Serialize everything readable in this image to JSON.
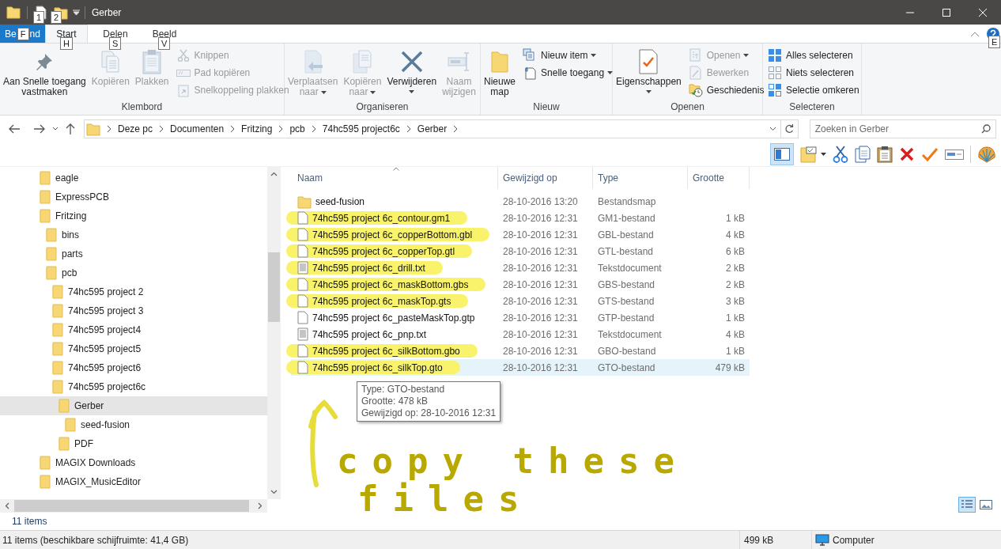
{
  "window": {
    "title": "Gerber",
    "quick_access_key_tips": [
      "1",
      "2"
    ]
  },
  "ribbon_tabs": [
    {
      "kind": "file",
      "label_parts": [
        "Be",
        "nd"
      ],
      "key_tip": "F",
      "selected": false
    },
    {
      "kind": "tab",
      "label": "Start",
      "key_tip": "H",
      "selected": true
    },
    {
      "kind": "tab",
      "label": "Delen",
      "key_tip": "S",
      "selected": false
    },
    {
      "kind": "tab",
      "label": "Beeld",
      "key_tip": "V",
      "selected": false
    }
  ],
  "help_key_tip": "E",
  "ribbon_groups": [
    {
      "label": "Klembord",
      "items": [
        {
          "kind": "large",
          "lines": [
            "Aan Snelle toegang",
            "vastmaken"
          ],
          "disabled": false,
          "dropdown": false
        },
        {
          "kind": "large",
          "lines": [
            "Kopiëren"
          ],
          "disabled": true,
          "dropdown": false
        },
        {
          "kind": "large",
          "lines": [
            "Plakken"
          ],
          "disabled": true,
          "dropdown": false
        },
        {
          "kind": "small",
          "lines": [
            "Knippen"
          ],
          "disabled": true,
          "dropdown": false
        },
        {
          "kind": "small",
          "lines": [
            "Pad kopiëren"
          ],
          "disabled": true,
          "dropdown": false
        },
        {
          "kind": "small",
          "lines": [
            "Snelkoppeling plakken"
          ],
          "disabled": true,
          "dropdown": false
        }
      ]
    },
    {
      "label": "Organiseren",
      "items": [
        {
          "kind": "large",
          "lines": [
            "Verplaatsen",
            "naar"
          ],
          "disabled": true,
          "dropdown": true
        },
        {
          "kind": "large",
          "lines": [
            "Kopiëren",
            "naar"
          ],
          "disabled": true,
          "dropdown": true
        },
        {
          "kind": "large",
          "lines": [
            "Verwijderen"
          ],
          "disabled": false,
          "dropdown": true
        },
        {
          "kind": "large",
          "lines": [
            "Naam",
            "wijzigen"
          ],
          "disabled": true,
          "dropdown": false
        }
      ]
    },
    {
      "label": "Nieuw",
      "items": [
        {
          "kind": "large",
          "lines": [
            "Nieuwe",
            "map"
          ],
          "disabled": false,
          "dropdown": false
        },
        {
          "kind": "small",
          "lines": [
            "Nieuw item"
          ],
          "disabled": false,
          "dropdown": true
        },
        {
          "kind": "small",
          "lines": [
            "Snelle toegang"
          ],
          "disabled": false,
          "dropdown": true
        }
      ]
    },
    {
      "label": "Openen",
      "items": [
        {
          "kind": "large",
          "lines": [
            "Eigenschappen"
          ],
          "disabled": false,
          "dropdown": true
        },
        {
          "kind": "small",
          "lines": [
            "Openen"
          ],
          "disabled": true,
          "dropdown": true
        },
        {
          "kind": "small",
          "lines": [
            "Bewerken"
          ],
          "disabled": true,
          "dropdown": false
        },
        {
          "kind": "small",
          "lines": [
            "Geschiedenis"
          ],
          "disabled": false,
          "dropdown": false
        }
      ]
    },
    {
      "label": "Selecteren",
      "items": [
        {
          "kind": "small",
          "lines": [
            "Alles selecteren"
          ],
          "disabled": false,
          "dropdown": false
        },
        {
          "kind": "small",
          "lines": [
            "Niets selecteren"
          ],
          "disabled": false,
          "dropdown": false
        },
        {
          "kind": "small",
          "lines": [
            "Selectie omkeren"
          ],
          "disabled": false,
          "dropdown": false
        }
      ]
    }
  ],
  "address": {
    "crumbs": [
      "Deze pc",
      "Documenten",
      "Fritzing",
      "pcb",
      "74hc595 project6c",
      "Gerber"
    ]
  },
  "search": {
    "placeholder": "Zoeken in Gerber"
  },
  "preview_pane": {
    "on": true
  },
  "navigation": [
    {
      "label": "eagle",
      "selected": false
    },
    {
      "label": "ExpressPCB",
      "selected": false
    },
    {
      "label": "Fritzing",
      "selected": false,
      "children": [
        {
          "label": "bins",
          "selected": false
        },
        {
          "label": "parts",
          "selected": false
        },
        {
          "label": "pcb",
          "selected": false,
          "children": [
            {
              "label": "74hc595 project 2",
              "selected": false
            },
            {
              "label": "74hc595 project 3",
              "selected": false
            },
            {
              "label": "74hc595 project4",
              "selected": false
            },
            {
              "label": "74hc595 project5",
              "selected": false
            },
            {
              "label": "74hc595 project6",
              "selected": false
            },
            {
              "label": "74hc595 project6c",
              "selected": false,
              "children": [
                {
                  "label": "Gerber",
                  "selected": true,
                  "children": [
                    {
                      "label": "seed-fusion",
                      "selected": false
                    }
                  ]
                },
                {
                  "label": "PDF",
                  "selected": false
                }
              ]
            }
          ]
        }
      ]
    },
    {
      "label": "MAGIX Downloads",
      "selected": false
    },
    {
      "label": "MAGIX_MusicEditor",
      "selected": false
    }
  ],
  "table": {
    "columns": [
      "Naam",
      "Gewijzigd op",
      "Type",
      "Grootte"
    ],
    "rows": [
      {
        "kind": "folder",
        "name": "seed-fusion",
        "modified": "28-10-2016 13:20",
        "type": "Bestandsmap",
        "size": "",
        "highlighted": false,
        "selected": false
      },
      {
        "kind": "file",
        "name": "74hc595 project 6c_contour.gm1",
        "modified": "28-10-2016 12:31",
        "type": "GM1-bestand",
        "size": "1 kB",
        "highlighted": true,
        "selected": false
      },
      {
        "kind": "file",
        "name": "74hc595 project 6c_copperBottom.gbl",
        "modified": "28-10-2016 12:31",
        "type": "GBL-bestand",
        "size": "4 kB",
        "highlighted": true,
        "selected": false
      },
      {
        "kind": "file",
        "name": "74hc595 project 6c_copperTop.gtl",
        "modified": "28-10-2016 12:31",
        "type": "GTL-bestand",
        "size": "6 kB",
        "highlighted": true,
        "selected": false
      },
      {
        "kind": "text",
        "name": "74hc595 project 6c_drill.txt",
        "modified": "28-10-2016 12:31",
        "type": "Tekstdocument",
        "size": "2 kB",
        "highlighted": true,
        "selected": false
      },
      {
        "kind": "file",
        "name": "74hc595 project 6c_maskBottom.gbs",
        "modified": "28-10-2016 12:31",
        "type": "GBS-bestand",
        "size": "2 kB",
        "highlighted": true,
        "selected": false
      },
      {
        "kind": "file",
        "name": "74hc595 project 6c_maskTop.gts",
        "modified": "28-10-2016 12:31",
        "type": "GTS-bestand",
        "size": "3 kB",
        "highlighted": true,
        "selected": false
      },
      {
        "kind": "file",
        "name": "74hc595 project 6c_pasteMaskTop.gtp",
        "modified": "28-10-2016 12:31",
        "type": "GTP-bestand",
        "size": "1 kB",
        "highlighted": false,
        "selected": false
      },
      {
        "kind": "text",
        "name": "74hc595 project 6c_pnp.txt",
        "modified": "28-10-2016 12:31",
        "type": "Tekstdocument",
        "size": "4 kB",
        "highlighted": false,
        "selected": false
      },
      {
        "kind": "file",
        "name": "74hc595 project 6c_silkBottom.gbo",
        "modified": "28-10-2016 12:31",
        "type": "GBO-bestand",
        "size": "1 kB",
        "highlighted": true,
        "selected": false
      },
      {
        "kind": "file",
        "name": "74hc595 project 6c_silkTop.gto",
        "modified": "28-10-2016 12:31",
        "type": "GTO-bestand",
        "size": "479 kB",
        "highlighted": true,
        "selected": true
      }
    ]
  },
  "tooltip": {
    "lines": [
      "Type: GTO-bestand",
      "Grootte: 478 kB",
      "Gewijzigd op: 28-10-2016 12:31"
    ]
  },
  "annotation": {
    "lines": [
      "copy these",
      "files"
    ]
  },
  "pane_status": "11 items",
  "view_modes": [
    {
      "kind": "details",
      "selected": true
    },
    {
      "kind": "tiles",
      "selected": false
    }
  ],
  "status_bar": {
    "items": "11 items (beschikbare schijfruimte: 41,4 GB)",
    "size": "499 kB",
    "location": "Computer"
  }
}
